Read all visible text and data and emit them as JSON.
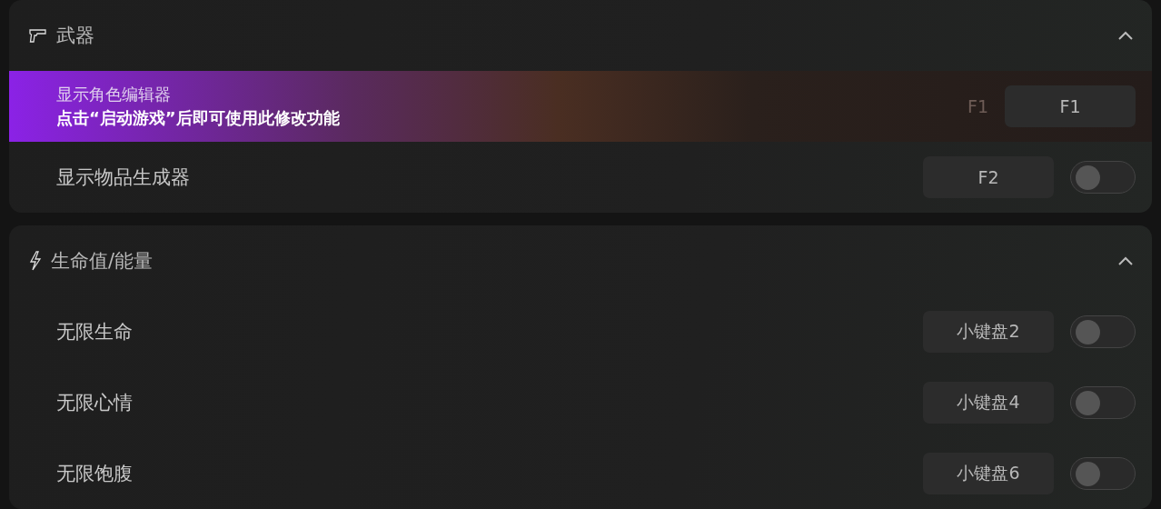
{
  "sections": [
    {
      "kind": "weapons",
      "title": "武器",
      "expanded": true,
      "rows": [
        {
          "kind": "notice",
          "label": "显示角色编辑器",
          "notice": "点击“启动游戏”后即可使用此修改功能",
          "ghost": "F1",
          "hotkey": "F1"
        },
        {
          "kind": "toggle",
          "label": "显示物品生成器",
          "hotkey": "F2",
          "on": false
        }
      ]
    },
    {
      "kind": "vitals",
      "title": "生命值/能量",
      "expanded": true,
      "rows": [
        {
          "kind": "toggle",
          "label": "无限生命",
          "hotkey": "小键盘2",
          "on": false
        },
        {
          "kind": "toggle",
          "label": "无限心情",
          "hotkey": "小键盘4",
          "on": false
        },
        {
          "kind": "toggle",
          "label": "无限饱腹",
          "hotkey": "小键盘6",
          "on": false
        }
      ]
    }
  ]
}
